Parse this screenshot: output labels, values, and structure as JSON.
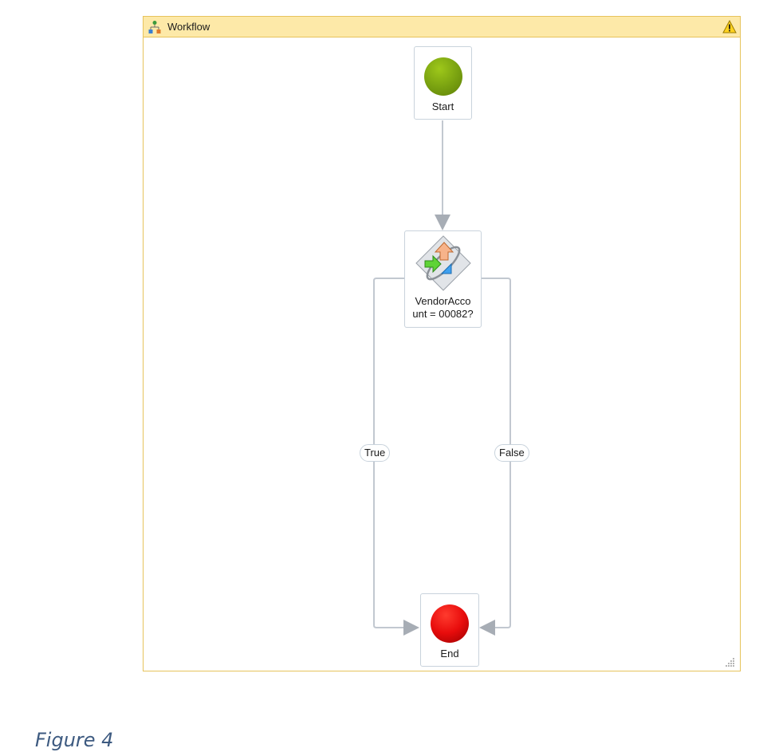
{
  "designer": {
    "title": "Workflow",
    "icons": {
      "title": "flowchart-icon",
      "warning": "warning-icon",
      "resize": "resize-grip-icon"
    }
  },
  "nodes": {
    "start": {
      "label": "Start",
      "icon": "start-circle-icon",
      "color": "#78a010"
    },
    "decision": {
      "label": "VendorAcco\nunt = 00082?",
      "icon": "flow-decision-icon"
    },
    "end": {
      "label": "End",
      "icon": "end-circle-icon",
      "color": "#e80c0c"
    }
  },
  "branches": {
    "true_label": "True",
    "false_label": "False"
  },
  "caption": "Figure 4",
  "colors": {
    "header_bg": "#fde9a8",
    "border": "#e6c35c",
    "connector": "#c2c8d0"
  }
}
